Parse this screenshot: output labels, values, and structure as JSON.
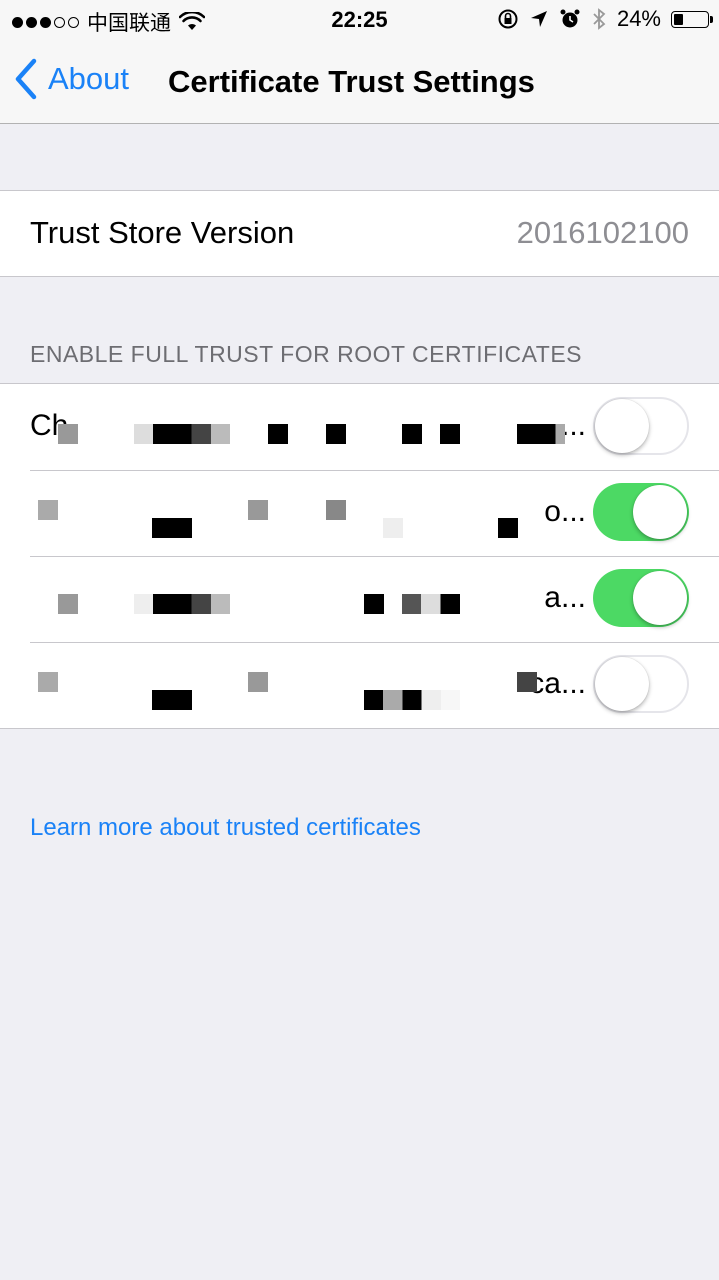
{
  "status_bar": {
    "carrier": "中国联通",
    "time": "22:25",
    "battery": "24%",
    "battery_level": 0.24,
    "icons": [
      "signal-dots",
      "wifi-icon",
      "rotation-lock-icon",
      "location-icon",
      "alarm-icon",
      "bluetooth-icon",
      "battery-icon"
    ]
  },
  "nav": {
    "back_label": "About",
    "title": "Certificate Trust Settings"
  },
  "trust_store": {
    "label": "Trust Store Version",
    "value": "2016102100"
  },
  "section_header": "ENABLE FULL TRUST FOR ROOT CERTIFICATES",
  "certificates": [
    {
      "label_visible_start": "Ch",
      "label_visible_end": "...",
      "enabled": false
    },
    {
      "label_visible_start": "",
      "label_visible_end": "o...",
      "enabled": true
    },
    {
      "label_visible_start": "",
      "label_visible_end": "a...",
      "enabled": true
    },
    {
      "label_visible_start": "",
      "label_visible_end": "ca...",
      "enabled": false
    }
  ],
  "learn_more": "Learn more about trusted certificates",
  "colors": {
    "accent": "#1a82f7",
    "toggle_on": "#4cd964",
    "background": "#efeff4"
  }
}
